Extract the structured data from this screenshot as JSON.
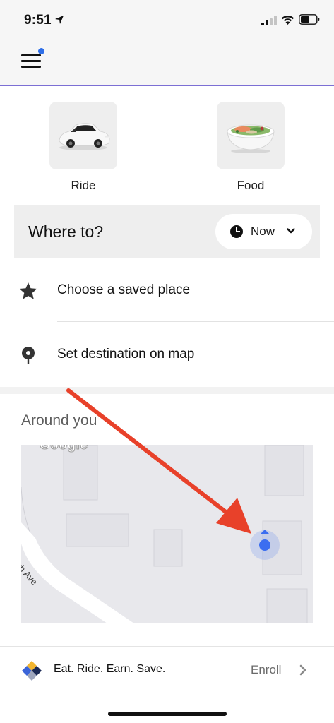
{
  "status_bar": {
    "time": "9:51",
    "icons": [
      "location-arrow-icon",
      "cellular-signal-icon",
      "wifi-icon",
      "battery-icon"
    ]
  },
  "header": {
    "menu_icon": "hamburger-menu-icon",
    "notification_dot_color": "#2f6fe8",
    "accent_line_color": "#7c6fd4"
  },
  "services": [
    {
      "label": "Ride",
      "icon": "car-icon"
    },
    {
      "label": "Food",
      "icon": "food-bowl-icon"
    }
  ],
  "where_to": {
    "label": "Where to?",
    "schedule": {
      "label": "Now",
      "icon": "clock-icon",
      "chevron": "chevron-down-icon"
    }
  },
  "options": [
    {
      "label": "Choose a saved place",
      "icon": "star-icon"
    },
    {
      "label": "Set destination on map",
      "icon": "map-pin-icon"
    }
  ],
  "around": {
    "title": "Around you",
    "map": {
      "watermark": "Google",
      "street_label": "Erb Ave",
      "user_location_color": "#3b6ef0"
    }
  },
  "promo": {
    "text": "Eat. Ride. Earn. Save.",
    "action": "Enroll",
    "icon": "rewards-diamond-icon"
  },
  "annotation": {
    "arrow_color": "#e8412a"
  }
}
